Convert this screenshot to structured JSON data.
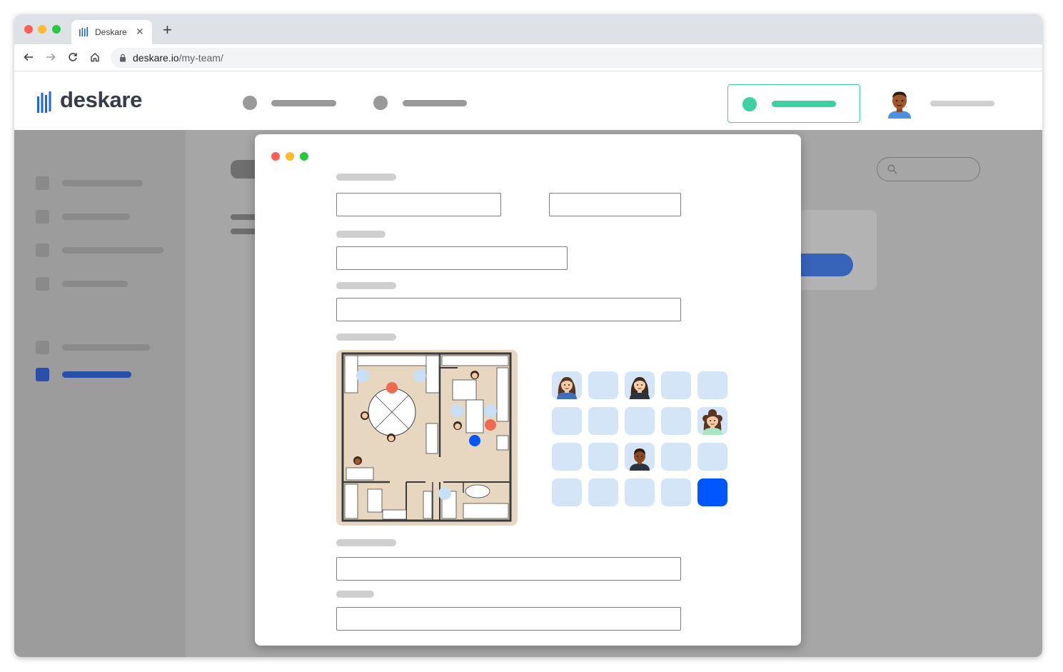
{
  "browser": {
    "tab_title": "Deskare",
    "tab_close_icon": "close-icon",
    "new_tab_icon": "plus-icon",
    "url_host": "deskare.io",
    "url_path": "/my-team/"
  },
  "app": {
    "logo_text": "deskare",
    "accent_color": "#3ecfa4",
    "brand_color": "#1e63e9"
  },
  "seats": {
    "rows": 4,
    "columns": 5,
    "occupied": [
      {
        "row": 1,
        "col": 1,
        "avatar": "woman-brown-hair"
      },
      {
        "row": 1,
        "col": 3,
        "avatar": "woman-blonde"
      },
      {
        "row": 2,
        "col": 5,
        "avatar": "woman-curly-hair"
      },
      {
        "row": 3,
        "col": 3,
        "avatar": "man-dark-skin"
      }
    ],
    "selected": {
      "row": 4,
      "col": 5
    },
    "seat_color": "#d3e5f6",
    "selected_color": "#0057ff"
  }
}
